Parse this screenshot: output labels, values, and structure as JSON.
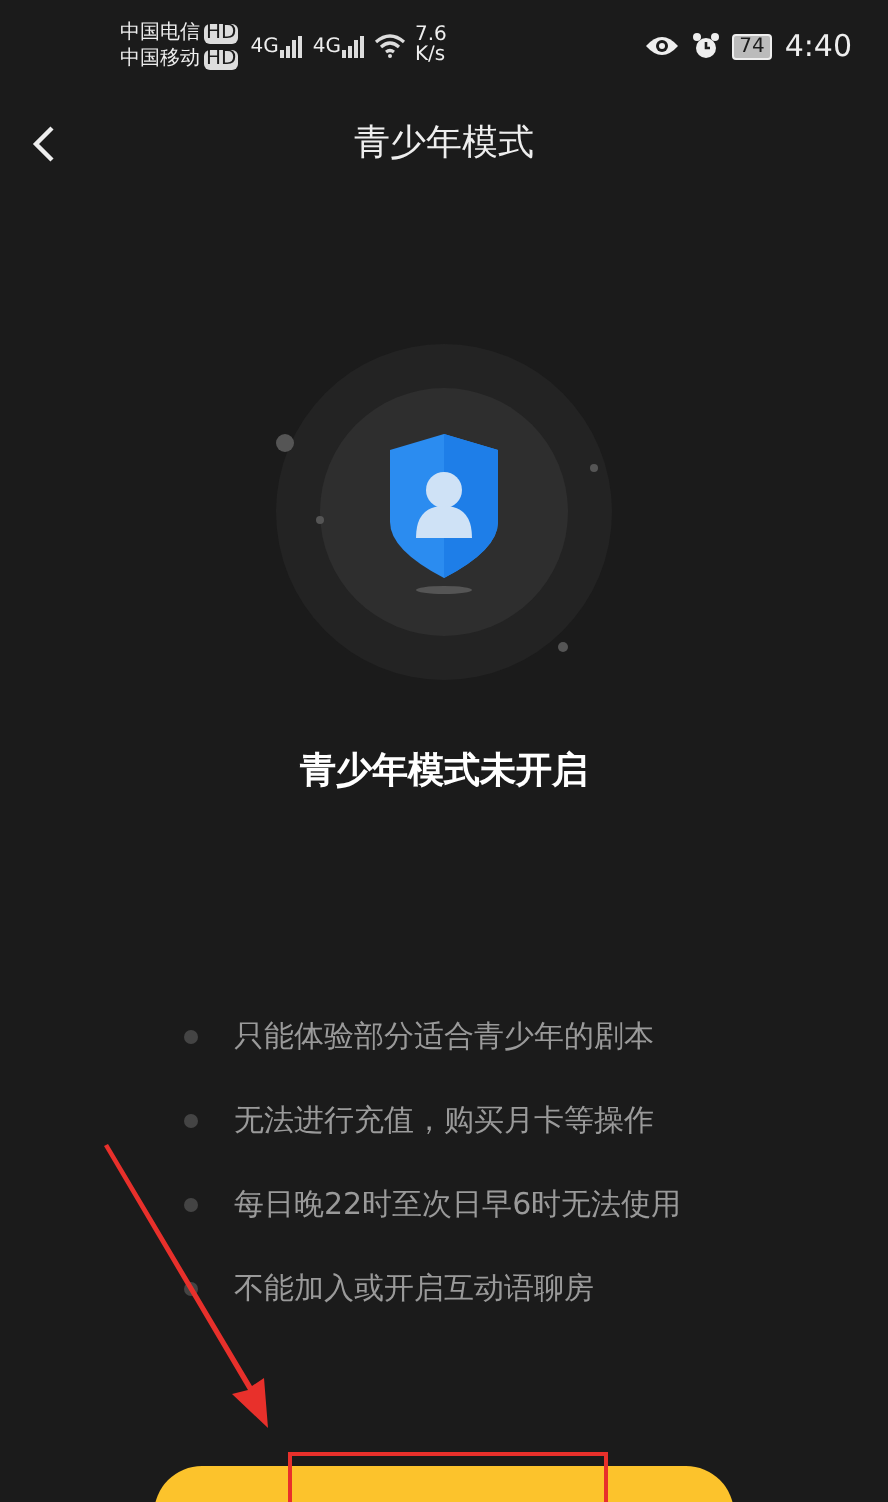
{
  "status_bar": {
    "carriers": [
      {
        "name": "中国电信",
        "badge": "HD",
        "network": "4G"
      },
      {
        "name": "中国移动",
        "badge": "HD",
        "network": "4G"
      }
    ],
    "speed_value": "7.6",
    "speed_unit": "K/s",
    "battery": "74",
    "time": "4:40"
  },
  "nav": {
    "title": "青少年模式"
  },
  "status_heading": "青少年模式未开启",
  "restrictions": [
    "只能体验部分适合青少年的剧本",
    "无法进行充值，购买月卡等操作",
    "每日晚22时至次日早6时无法使用",
    "不能加入或开启互动语聊房"
  ]
}
